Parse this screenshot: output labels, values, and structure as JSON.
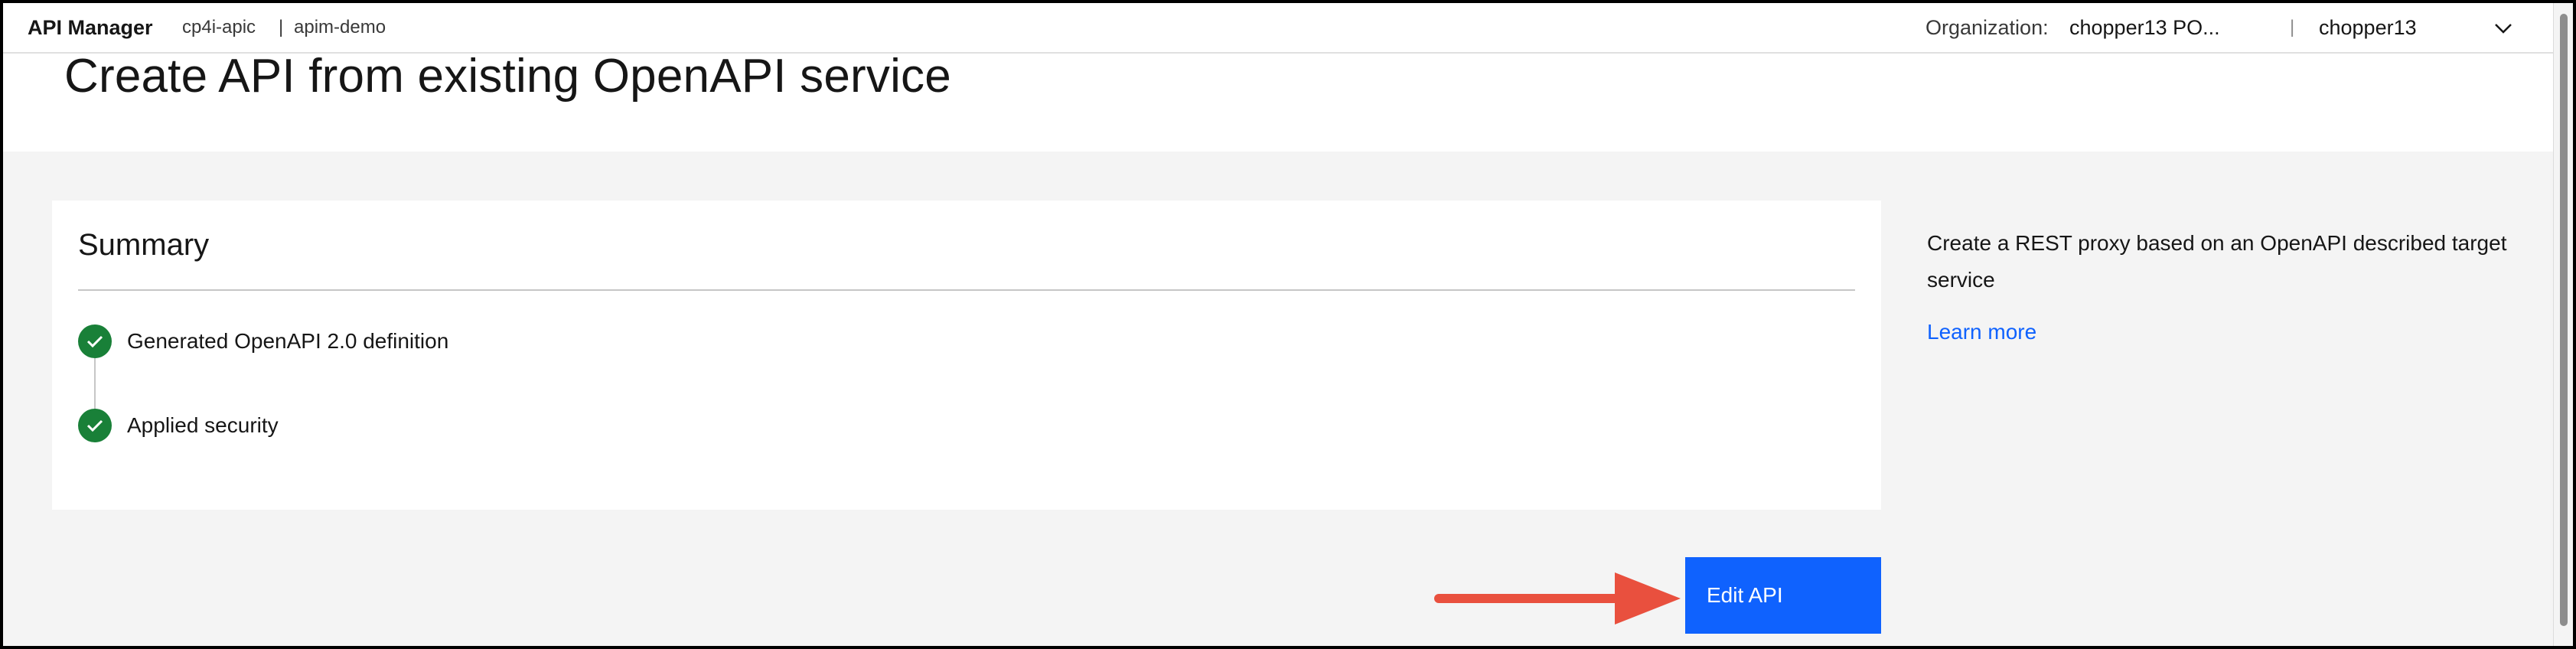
{
  "header": {
    "app_name": "API Manager",
    "catalog": "cp4i-apic",
    "separator": "|",
    "instance": "apim-demo",
    "org_label": "Organization:",
    "org_value": "chopper13 PO...",
    "divider": "|",
    "user": "chopper13"
  },
  "page": {
    "title": "Create API from existing OpenAPI service"
  },
  "summary": {
    "title": "Summary",
    "steps": [
      {
        "label": "Generated OpenAPI 2.0 definition",
        "status": "complete"
      },
      {
        "label": "Applied security",
        "status": "complete"
      }
    ]
  },
  "sidebar": {
    "description": "Create a REST proxy based on an OpenAPI described target service",
    "learn_more": "Learn more"
  },
  "actions": {
    "edit_api": "Edit API"
  },
  "icons": {
    "step_status": "checkmark-icon",
    "account_menu": "chevron-down-icon",
    "callout": "arrow-right-icon"
  },
  "colors": {
    "primary": "#0f62fe",
    "success": "#198038",
    "callout_arrow": "#e9503e",
    "background": "#f4f4f4"
  }
}
